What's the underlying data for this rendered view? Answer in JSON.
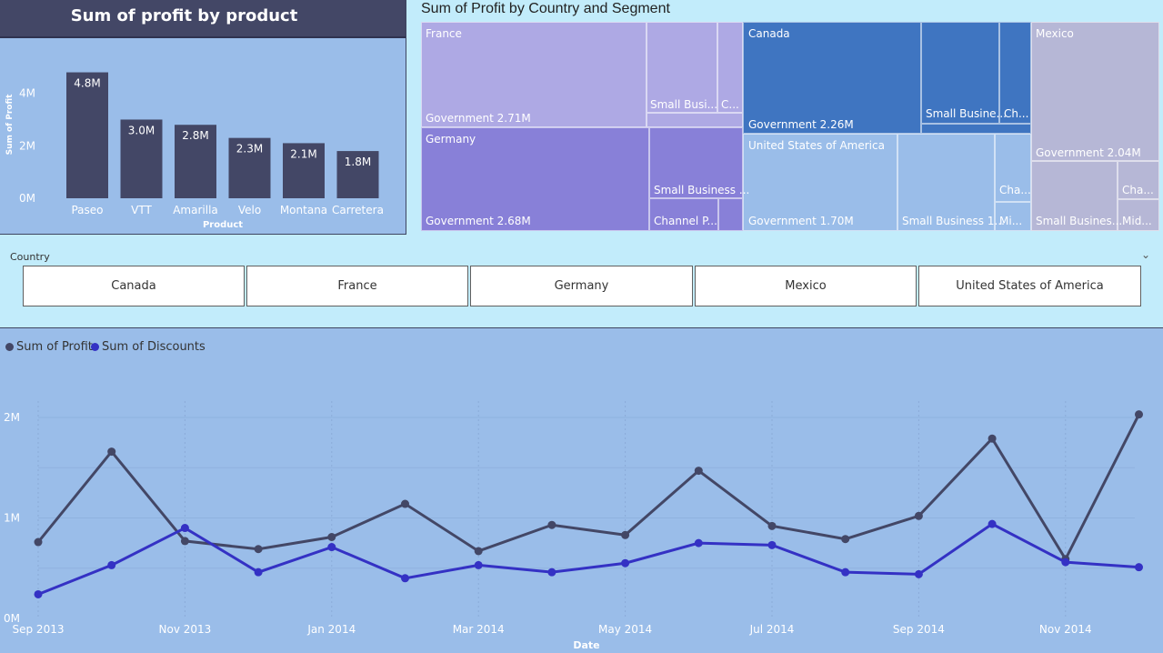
{
  "bar_chart": {
    "title": "Sum of profit by product",
    "chart_data": {
      "type": "bar",
      "categories": [
        "Paseo",
        "VTT",
        "Amarilla",
        "Velo",
        "Montana",
        "Carretera"
      ],
      "values": [
        4.8,
        3.0,
        2.8,
        2.3,
        2.1,
        1.8
      ],
      "data_labels": [
        "4.8M",
        "3.0M",
        "2.8M",
        "2.3M",
        "2.1M",
        "1.8M"
      ],
      "xlabel": "Product",
      "ylabel": "Sum of Profit",
      "y_ticks": [
        "0M",
        "2M",
        "4M"
      ],
      "ylim": [
        0,
        5.2
      ],
      "color": "#434766"
    }
  },
  "treemap": {
    "title": "Sum of Profit by Country and Segment",
    "chart_data": {
      "type": "treemap",
      "countries": [
        {
          "name": "France",
          "color": "#aea9e4",
          "segments": [
            {
              "label": "Government 2.71M"
            },
            {
              "label": "Small Busi..."
            },
            {
              "label": "C..."
            }
          ]
        },
        {
          "name": "Germany",
          "color": "#8880d8",
          "segments": [
            {
              "label": "Government 2.68M"
            },
            {
              "label": "Small Business ..."
            },
            {
              "label": "Channel P..."
            }
          ]
        },
        {
          "name": "Canada",
          "color": "#3f75c1",
          "segments": [
            {
              "label": "Government 2.26M"
            },
            {
              "label": "Small Busine..."
            },
            {
              "label": "Ch..."
            }
          ]
        },
        {
          "name": "United States of America",
          "color": "#9abde9",
          "segments": [
            {
              "label": "Government 1.70M"
            },
            {
              "label": "Small Business 1..."
            },
            {
              "label": "Cha..."
            },
            {
              "label": "Mi..."
            }
          ]
        },
        {
          "name": "Mexico",
          "color": "#b6b7d6",
          "segments": [
            {
              "label": "Government 2.04M"
            },
            {
              "label": "Small Busines..."
            },
            {
              "label": "Cha..."
            },
            {
              "label": "Mid..."
            }
          ]
        }
      ]
    }
  },
  "slicer": {
    "label": "Country",
    "options": [
      "Canada",
      "France",
      "Germany",
      "Mexico",
      "United States of America"
    ]
  },
  "line_chart": {
    "chart_data": {
      "type": "line",
      "x": [
        "2013-09",
        "2013-10",
        "2013-11",
        "2013-12",
        "2014-01",
        "2014-02",
        "2014-03",
        "2014-04",
        "2014-05",
        "2014-06",
        "2014-07",
        "2014-08",
        "2014-09",
        "2014-10",
        "2014-11",
        "2014-12"
      ],
      "series": [
        {
          "name": "Sum of Profit",
          "color": "#434766",
          "values": [
            0.76,
            1.66,
            0.77,
            0.69,
            0.81,
            1.14,
            0.67,
            0.93,
            0.83,
            1.47,
            0.92,
            0.79,
            1.02,
            1.79,
            0.59,
            2.03
          ]
        },
        {
          "name": "Sum of Discounts",
          "color": "#3431c4",
          "values": [
            0.24,
            0.53,
            0.9,
            0.46,
            0.71,
            0.4,
            0.53,
            0.46,
            0.55,
            0.75,
            0.73,
            0.46,
            0.44,
            0.94,
            0.56,
            0.51
          ]
        }
      ],
      "x_ticks": [
        "Sep 2013",
        "Nov 2013",
        "Jan 2014",
        "Mar 2014",
        "May 2014",
        "Jul 2014",
        "Sep 2014",
        "Nov 2014"
      ],
      "y_ticks": [
        "0M",
        "1M",
        "2M"
      ],
      "ylim": [
        0,
        2.0
      ],
      "xlabel": "Date",
      "ylabel": ""
    }
  }
}
